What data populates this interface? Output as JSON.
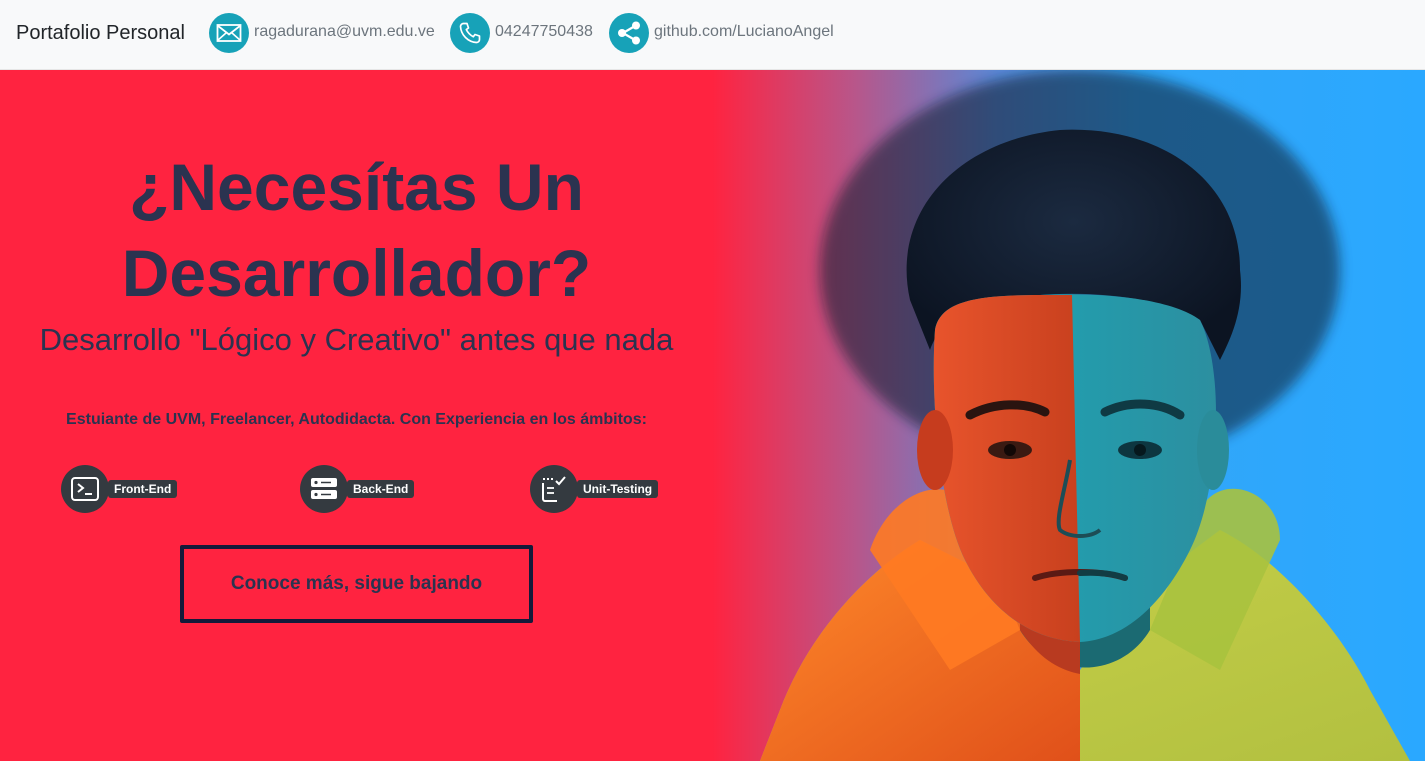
{
  "navbar": {
    "brand": "Portafolio Personal",
    "contacts": [
      {
        "icon": "envelope-icon",
        "text": "ragadurana@uvm.edu.ve"
      },
      {
        "icon": "phone-icon",
        "text": "04247750438"
      },
      {
        "icon": "share-icon",
        "text": "github.com/LucianoAngel"
      }
    ]
  },
  "hero": {
    "title_line1": "¿Necesítas Un",
    "title_line2": "Desarrollador?",
    "subtitle": "Desarrollo \"Lógico y Creativo\" antes que nada",
    "experience": "Estuiante de UVM, Freelancer, Autodidacta. Con Experiencia en los ámbitos:",
    "skills": [
      {
        "icon": "terminal-icon",
        "label": "Front-End"
      },
      {
        "icon": "server-icon",
        "label": "Back-End"
      },
      {
        "icon": "checklist-icon",
        "label": "Unit-Testing"
      }
    ],
    "cta_label": "Conoce más, sigue bajando",
    "photo": "portrait-photo"
  },
  "colors": {
    "hero_red": "#ff2340",
    "hero_blue": "#2aa8ff",
    "text_navy": "#2b3350",
    "contact_teal": "#17a2b8",
    "skill_dark": "#343a40",
    "navbar_bg": "#f8f9fa"
  }
}
